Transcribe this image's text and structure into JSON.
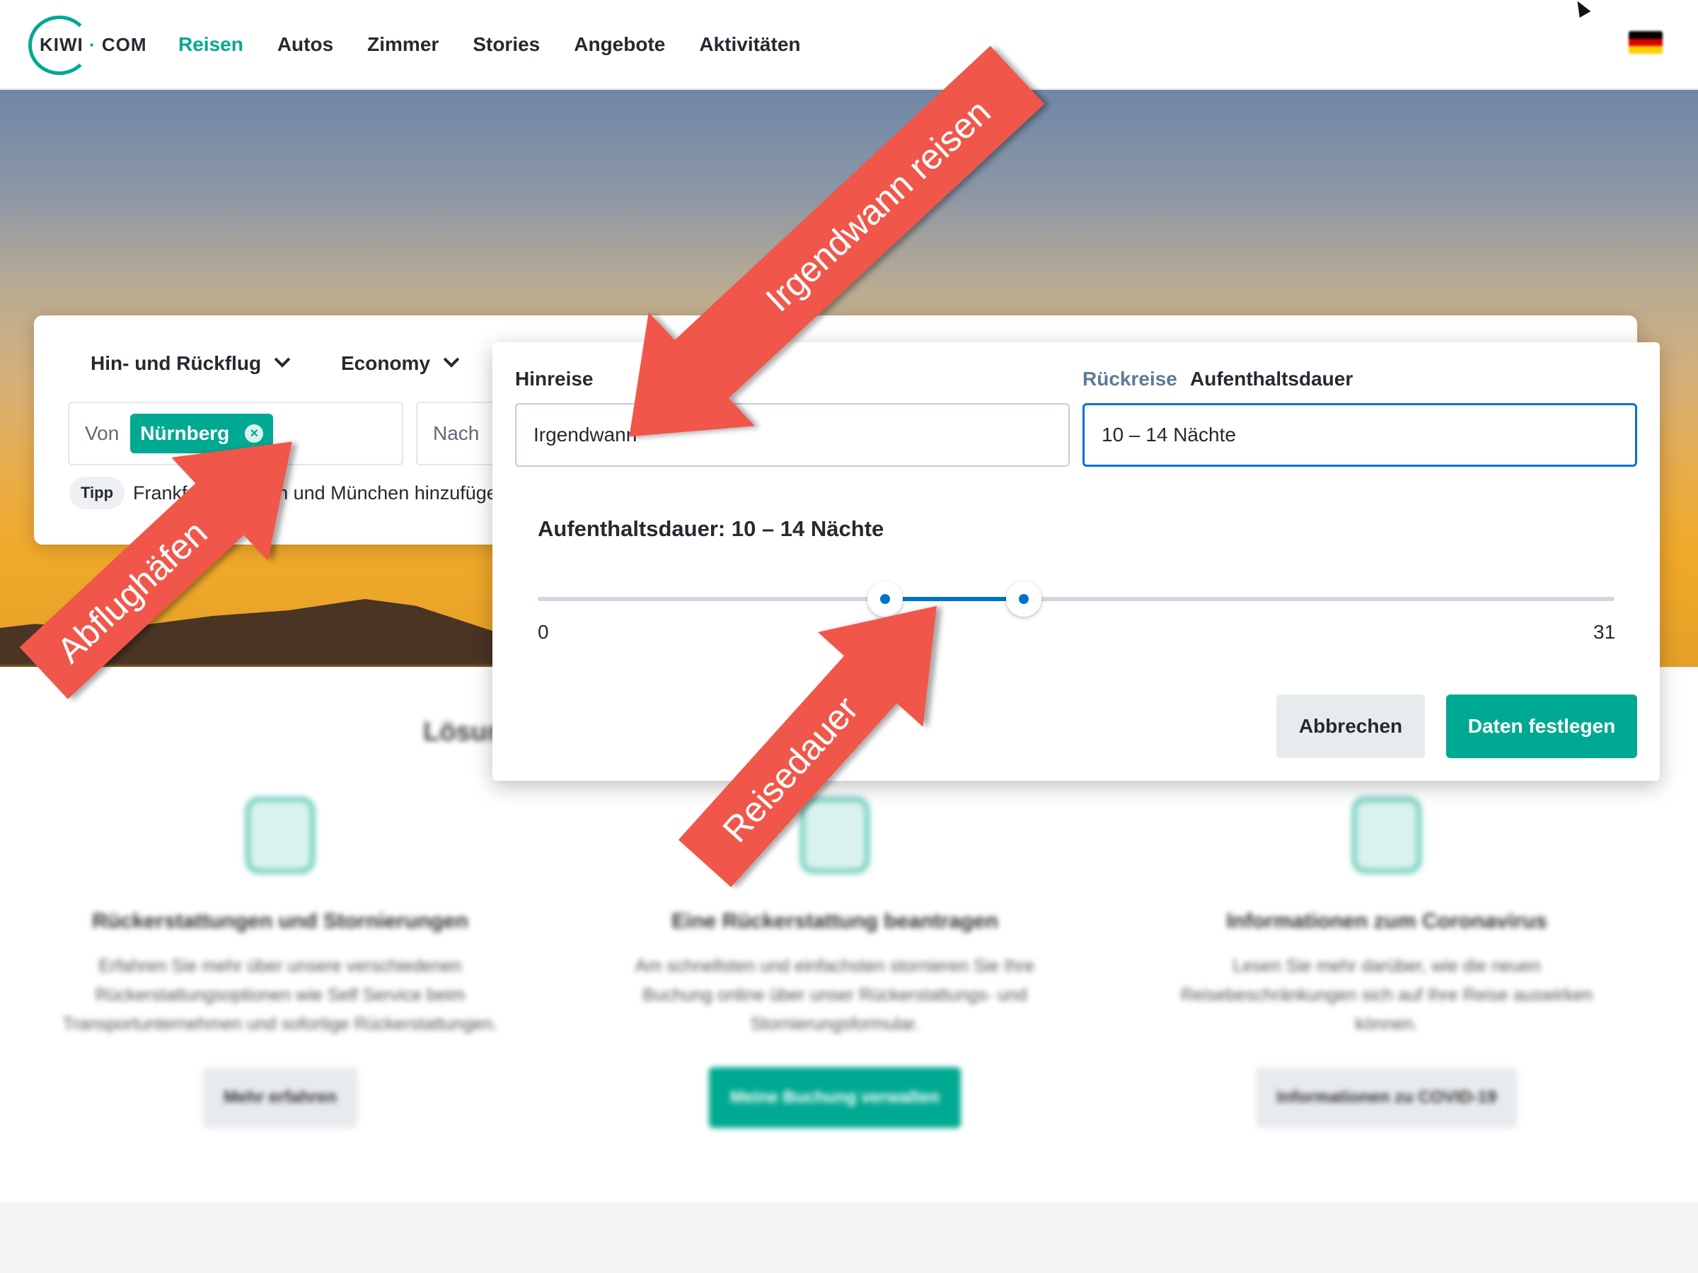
{
  "brand": {
    "logo_left": "KIWI",
    "logo_dot": "·",
    "logo_right": "COM"
  },
  "nav": {
    "items": [
      {
        "label": "Reisen",
        "active": true
      },
      {
        "label": "Autos"
      },
      {
        "label": "Zimmer"
      },
      {
        "label": "Stories"
      },
      {
        "label": "Angebote"
      },
      {
        "label": "Aktivitäten"
      }
    ]
  },
  "search": {
    "trip_type": "Hin- und Rückflug",
    "cabin_class": "Economy",
    "from_label": "Von",
    "from_chip": "Nürnberg",
    "to_label": "Nach",
    "tip_badge": "Tipp",
    "tip_text": "Frankfurt am Main und München hinzufügen"
  },
  "date_picker": {
    "outbound_label": "Hinreise",
    "return_label": "Rückreise",
    "stay_label": "Aufenthaltsdauer",
    "outbound_value": "Irgendwann",
    "stay_value": "10 – 14 Nächte",
    "duration_title": "Aufenthaltsdauer: 10 – 14 Nächte",
    "range": {
      "min": 0,
      "max": 31,
      "low": 10,
      "high": 14
    },
    "range_min_label": "0",
    "range_max_label": "31",
    "cancel_label": "Abbrechen",
    "confirm_label": "Daten festlegen"
  },
  "section": {
    "title": "Lösungen",
    "cards": [
      {
        "icon": "shield-euro-icon",
        "title": "Rückerstattungen und Stornierungen",
        "text": "Erfahren Sie mehr über unsere verschiedenen Rückerstattungsoptionen wie Self Service beim Transportunternehmen und sofortige Rückerstattungen.",
        "button": "Mehr erfahren"
      },
      {
        "icon": "refund-tag-icon",
        "title": "Eine Rückerstattung beantragen",
        "text": "Am schnellsten und einfachsten stornieren Sie Ihre Buchung online über unser Rückerstattungs- und Stornierungsformular.",
        "button": "Meine Buchung verwalten"
      },
      {
        "icon": "travel-restrictions-icon",
        "title": "Informationen zum Coronavirus",
        "text": "Lesen Sie mehr darüber, wie die neuen Reisebeschränkungen sich auf Ihre Reise auswirken können.",
        "button": "Informationen zu COVID-19"
      }
    ]
  },
  "annotations": {
    "anywhen": "Irgendwann reisen",
    "airports": "Abflughäfen",
    "duration": "Reisedauer"
  },
  "colors": {
    "accent": "#00a991",
    "focus": "#0172cb",
    "annotation": "#f0574a"
  }
}
